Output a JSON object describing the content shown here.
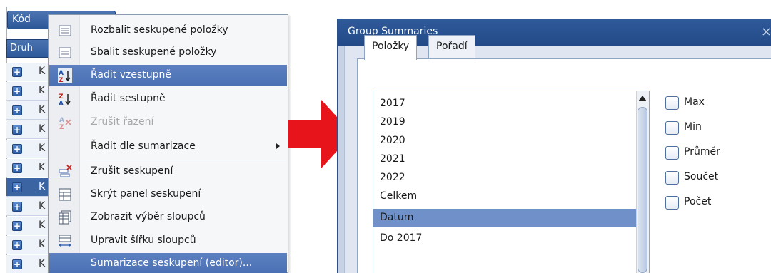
{
  "grid": {
    "kod_header": "Kód",
    "druh_header": "Druh",
    "row_letter": "K",
    "plus_glyph": "+"
  },
  "context_menu": {
    "items": [
      {
        "label": "Rozbalit seskupené položky",
        "icon": "expand-groups-icon"
      },
      {
        "label": "Sbalit seskupené položky",
        "icon": "collapse-groups-icon"
      },
      {
        "label": "Řadit vzestupně",
        "icon": "sort-ascending-icon",
        "highlighted": true
      },
      {
        "label": "Řadit sestupně",
        "icon": "sort-descending-icon"
      },
      {
        "label": "Zrušit řazení",
        "icon": "clear-sort-icon",
        "disabled": true
      },
      {
        "label": "Řadit dle sumarizace",
        "icon": "",
        "submenu": true
      },
      {
        "label": "Zrušit seskupení",
        "icon": "ungroup-icon"
      },
      {
        "label": "Skrýt panel seskupení",
        "icon": "hide-group-panel-icon"
      },
      {
        "label": "Zobrazit výběr sloupců",
        "icon": "column-chooser-icon"
      },
      {
        "label": "Upravit šířku sloupců",
        "icon": "best-fit-icon"
      },
      {
        "label": "Sumarizace seskupení (editor)...",
        "icon": "",
        "highlighted": true
      }
    ],
    "sort_asc_glyph_top": "A",
    "sort_asc_glyph_bottom": "Z",
    "sort_desc_glyph_top": "Z",
    "sort_desc_glyph_bottom": "A"
  },
  "dialog": {
    "title": "Group Summaries",
    "close_glyph": "×",
    "tabs": [
      {
        "label": "Položky",
        "active": true
      },
      {
        "label": "Pořadí",
        "active": false
      }
    ],
    "list_items": [
      "2017",
      "2019",
      "2020",
      "2021",
      "2022",
      "Celkem",
      "Datum",
      "Do 2017"
    ],
    "selected_item": "Datum",
    "checkboxes": [
      {
        "label": "Max",
        "checked": false
      },
      {
        "label": "Min",
        "checked": false
      },
      {
        "label": "Průměr",
        "checked": false
      },
      {
        "label": "Součet",
        "checked": false
      },
      {
        "label": "Počet",
        "checked": false
      }
    ]
  },
  "colors": {
    "accent_blue": "#2f5a9b",
    "menu_highlight": "#5c80c0",
    "list_selection": "#6f90c9",
    "arrow_red": "#e8141c"
  }
}
